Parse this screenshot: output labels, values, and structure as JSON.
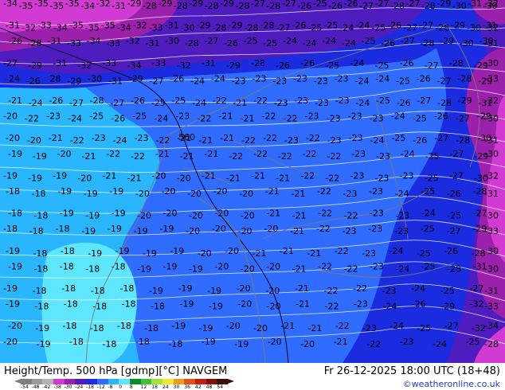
{
  "footer": {
    "title": "Height/Temp. 500 hPa [gdmp][°C] NAVGEM",
    "valid_time": "Fr 26-12-2025 18:00 UTC (18+48)",
    "credit": "©weatheronline.co.uk"
  },
  "colorbar": {
    "ticks": [
      "-54",
      "-48",
      "-42",
      "-38",
      "-30",
      "-24",
      "-18",
      "-12",
      "-8",
      "0",
      "8",
      "12",
      "18",
      "24",
      "30",
      "36",
      "42",
      "48",
      "54"
    ],
    "colors": [
      "#7f7f7f",
      "#9a9a9a",
      "#b3b3b3",
      "#d13bd3",
      "#9b21ad",
      "#4f1cc0",
      "#1a2be0",
      "#2f6cff",
      "#29b6ff",
      "#5fe6ff",
      "#0c8a2c",
      "#3ec13a",
      "#a6e23b",
      "#f0e63a",
      "#ef9b1f",
      "#e0521b",
      "#c21d10",
      "#7d1208",
      "#3a0e06"
    ]
  },
  "map": {
    "geopotential_label": "560",
    "temperature_labels": [
      "-34",
      "-35",
      "-35",
      "-35",
      "-35",
      "-34",
      "-32",
      "-31",
      "-29",
      "-28",
      "-29",
      "-28",
      "-29",
      "-28",
      "-29",
      "-28",
      "-27",
      "-28",
      "-27",
      "-26",
      "-25",
      "-26",
      "-26",
      "-27",
      "-27",
      "-28",
      "-27",
      "-28",
      "-29",
      "-30",
      "-31",
      "-30",
      "-32",
      "-31",
      "-32",
      "-33",
      "-34",
      "-35",
      "-35",
      "-35",
      "-34",
      "-32",
      "-33",
      "-31",
      "-30",
      "-29",
      "-28",
      "-29",
      "-28",
      "-28",
      "-27",
      "-26",
      "-25",
      "-25",
      "-24",
      "-24",
      "-25",
      "-26",
      "-27",
      "-27",
      "-28",
      "-29",
      "-30",
      "-31",
      "-32",
      "-26",
      "-28",
      "-31",
      "-33",
      "-34",
      "-33",
      "-32",
      "-31",
      "-30",
      "-28",
      "-27",
      "-26",
      "-25",
      "-25",
      "-24",
      "-24",
      "-24",
      "-24",
      "-25",
      "-26",
      "-27",
      "-28",
      "-29",
      "-30",
      "-30",
      "-31",
      "-27",
      "-29",
      "-31",
      "-32",
      "-33",
      "-34",
      "-33",
      "-32",
      "-31",
      "-29",
      "-28",
      "-26",
      "-26",
      "-25",
      "-24",
      "-25",
      "-26",
      "-27",
      "-28",
      "-29",
      "-30",
      "-24",
      "-26",
      "-28",
      "-29",
      "-30",
      "-31",
      "-29",
      "-27",
      "-26",
      "-24",
      "-24",
      "-23",
      "-23",
      "-23",
      "-23",
      "-23",
      "-23",
      "-24",
      "-24",
      "-25",
      "-26",
      "-27",
      "-28",
      "-29",
      "-33",
      "-21",
      "-24",
      "-26",
      "-27",
      "-28",
      "-27",
      "-26",
      "-25",
      "-25",
      "-24",
      "-22",
      "-21",
      "-22",
      "-23",
      "-23",
      "-23",
      "-23",
      "-24",
      "-25",
      "-26",
      "-27",
      "-28",
      "-29",
      "-31",
      "-32",
      "-20",
      "-22",
      "-23",
      "-24",
      "-25",
      "-26",
      "-25",
      "-24",
      "-23",
      "-22",
      "-21",
      "-21",
      "-22",
      "-22",
      "-23",
      "-23",
      "-23",
      "-23",
      "-24",
      "-25",
      "-26",
      "-27",
      "-29",
      "-30",
      "-20",
      "-20",
      "-21",
      "-22",
      "-23",
      "-24",
      "-23",
      "-22",
      "-21",
      "-21",
      "-21",
      "-22",
      "-22",
      "-23",
      "-22",
      "-23",
      "-23",
      "-24",
      "-25",
      "-26",
      "-27",
      "-28",
      "-30",
      "-31",
      "-19",
      "-19",
      "-20",
      "-21",
      "-22",
      "-22",
      "-21",
      "-21",
      "-21",
      "-22",
      "-22",
      "-22",
      "-22",
      "-22",
      "-23",
      "-23",
      "-24",
      "-25",
      "-27",
      "-29",
      "-30",
      "-19",
      "-19",
      "-19",
      "-20",
      "-21",
      "-21",
      "-20",
      "-20",
      "-21",
      "-21",
      "-21",
      "-21",
      "-22",
      "-22",
      "-23",
      "-23",
      "-23",
      "-25",
      "-27",
      "-30",
      "-32",
      "-18",
      "-18",
      "-19",
      "-19",
      "-19",
      "-20",
      "-20",
      "-20",
      "-20",
      "-20",
      "-21",
      "-21",
      "-22",
      "-23",
      "-23",
      "-24",
      "-25",
      "-26",
      "-28",
      "-31",
      "-18",
      "-18",
      "-19",
      "-19",
      "-19",
      "-20",
      "-20",
      "-20",
      "-20",
      "-20",
      "-21",
      "-21",
      "-22",
      "-22",
      "-23",
      "-23",
      "-24",
      "-25",
      "-27",
      "-30",
      "-18",
      "-18",
      "-18",
      "-19",
      "-19",
      "-19",
      "-19",
      "-20",
      "-20",
      "-20",
      "-20",
      "-21",
      "-22",
      "-23",
      "-23",
      "-23",
      "-25",
      "-27",
      "-29",
      "-33",
      "-19",
      "-18",
      "-18",
      "-19",
      "-19",
      "-19",
      "-19",
      "-20",
      "-20",
      "-21",
      "-21",
      "-21",
      "-22",
      "-23",
      "-24",
      "-25",
      "-26",
      "-28",
      "-30",
      "-19",
      "-18",
      "-18",
      "-18",
      "-18",
      "-19",
      "-19",
      "-19",
      "-20",
      "-20",
      "-20",
      "-21",
      "-22",
      "-22",
      "-23",
      "-24",
      "-25",
      "-28",
      "-31",
      "-30",
      "-19",
      "-18",
      "-18",
      "-18",
      "-18",
      "-19",
      "-19",
      "-19",
      "-20",
      "-20",
      "-21",
      "-22",
      "-22",
      "-23",
      "-24",
      "-25",
      "-27",
      "-31",
      "-19",
      "-18",
      "-18",
      "-18",
      "-18",
      "-18",
      "-19",
      "-19",
      "-20",
      "-20",
      "-21",
      "-22",
      "-23",
      "-24",
      "-26",
      "-29",
      "-32",
      "-33",
      "-20",
      "-19",
      "-18",
      "-18",
      "-18",
      "-18",
      "-19",
      "-19",
      "-20",
      "-20",
      "-21",
      "-21",
      "-22",
      "-23",
      "-24",
      "-25",
      "-27",
      "-32",
      "-34",
      "-20",
      "-19",
      "-18",
      "-18",
      "-18",
      "-18",
      "-19",
      "-19",
      "-20",
      "-20",
      "-21",
      "-22",
      "-23",
      "-24",
      "-25",
      "-28"
    ]
  }
}
